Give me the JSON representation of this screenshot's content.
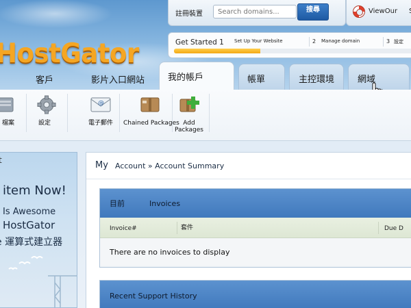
{
  "brand": {
    "logo_text": "HostGator"
  },
  "utility": {
    "register_label": "註冊裝置",
    "search_placeholder": "Search domains...",
    "search_button": "搜尋",
    "chat_label": "ViewOur",
    "chat_extra": "S"
  },
  "getting_started": {
    "title": "Get Started 1",
    "steps": [
      {
        "num": "",
        "label": "Set Up Your Website"
      },
      {
        "num": "2",
        "label": "Manage domain"
      },
      {
        "num": "3",
        "label": "設定"
      }
    ],
    "progress": 0.36
  },
  "nav": {
    "labels": [
      "客戶",
      "影片入口網站"
    ],
    "tabs": [
      {
        "label": "我的帳戶",
        "active": true
      },
      {
        "label": "帳單",
        "active": false
      },
      {
        "label": "主控環境",
        "active": false
      },
      {
        "label": "網域",
        "active": false
      }
    ]
  },
  "toolbar": {
    "items": [
      {
        "label": "檔案",
        "icon": "folder-icon"
      },
      {
        "label": "設定",
        "icon": "gear-icon"
      },
      {
        "label": "電子郵件",
        "icon": "email-icon"
      },
      {
        "label": "Chained Packages",
        "icon": "package-icon"
      },
      {
        "label": "Add\nPackages",
        "icon": "add-package-icon"
      }
    ]
  },
  "promo": {
    "mark": "t",
    "headline": "item Now!",
    "line1": "Is Awesome",
    "line2": "HostGator",
    "line3": "e 運算式建立器"
  },
  "breadcrumb": {
    "my": "My",
    "rest": "Account » Account Summary"
  },
  "invoices_panel": {
    "title": "目前",
    "tab": "Invoices",
    "columns": [
      "Invoice#",
      "套件",
      "Due D"
    ],
    "empty_message": "There are no invoices to display"
  },
  "support_panel": {
    "title": "Recent Support History"
  },
  "colors": {
    "accent_blue": "#4a82c4",
    "logo_orange": "#f5a623",
    "progress_yellow": "#f3a814"
  }
}
